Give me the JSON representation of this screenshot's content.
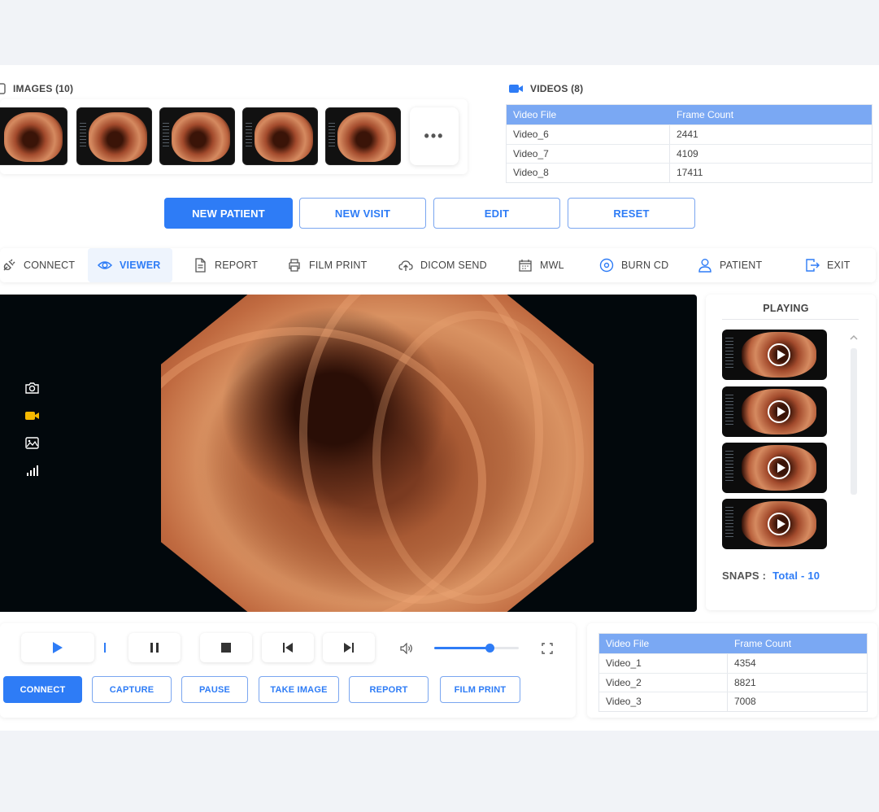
{
  "images_panel": {
    "title": "IMAGES (10)",
    "more_label": "•••"
  },
  "videos_panel": {
    "title": "VIDEOS (8)",
    "columns": [
      "Video File",
      "Frame Count"
    ],
    "rows": [
      [
        "Video_6",
        "2441"
      ],
      [
        "Video_7",
        "4109"
      ],
      [
        "Video_8",
        "17411"
      ]
    ]
  },
  "actions": {
    "new_patient": "NEW PATIENT",
    "new_visit": "NEW VISIT",
    "edit": "EDIT",
    "reset": "RESET"
  },
  "toolbar": {
    "connect": "CONNECT",
    "viewer": "VIEWER",
    "report": "REPORT",
    "film_print": "FILM PRINT",
    "dicom_send": "DICOM SEND",
    "mwl": "MWL",
    "burn_cd": "BURN CD",
    "patient": "PATIENT",
    "exit": "EXIT"
  },
  "playing_panel": {
    "title": "PLAYING",
    "snaps_label": "SNAPS :",
    "snaps_total": "Total - 10"
  },
  "controls": {
    "volume_level": 0.65,
    "connect": "CONNECT",
    "capture": "CAPTURE",
    "pause": "PAUSE",
    "take_image": "TAKE IMAGE",
    "report": "REPORT",
    "film_print": "FILM PRINT"
  },
  "bottom_table": {
    "columns": [
      "Video File",
      "Frame Count"
    ],
    "rows": [
      [
        "Video_1",
        "4354"
      ],
      [
        "Video_2",
        "8821"
      ],
      [
        "Video_3",
        "7008"
      ]
    ]
  },
  "colors": {
    "accent": "#2e7cf6",
    "table_header": "#7aa8f3",
    "video_icon": "#f5b800"
  }
}
